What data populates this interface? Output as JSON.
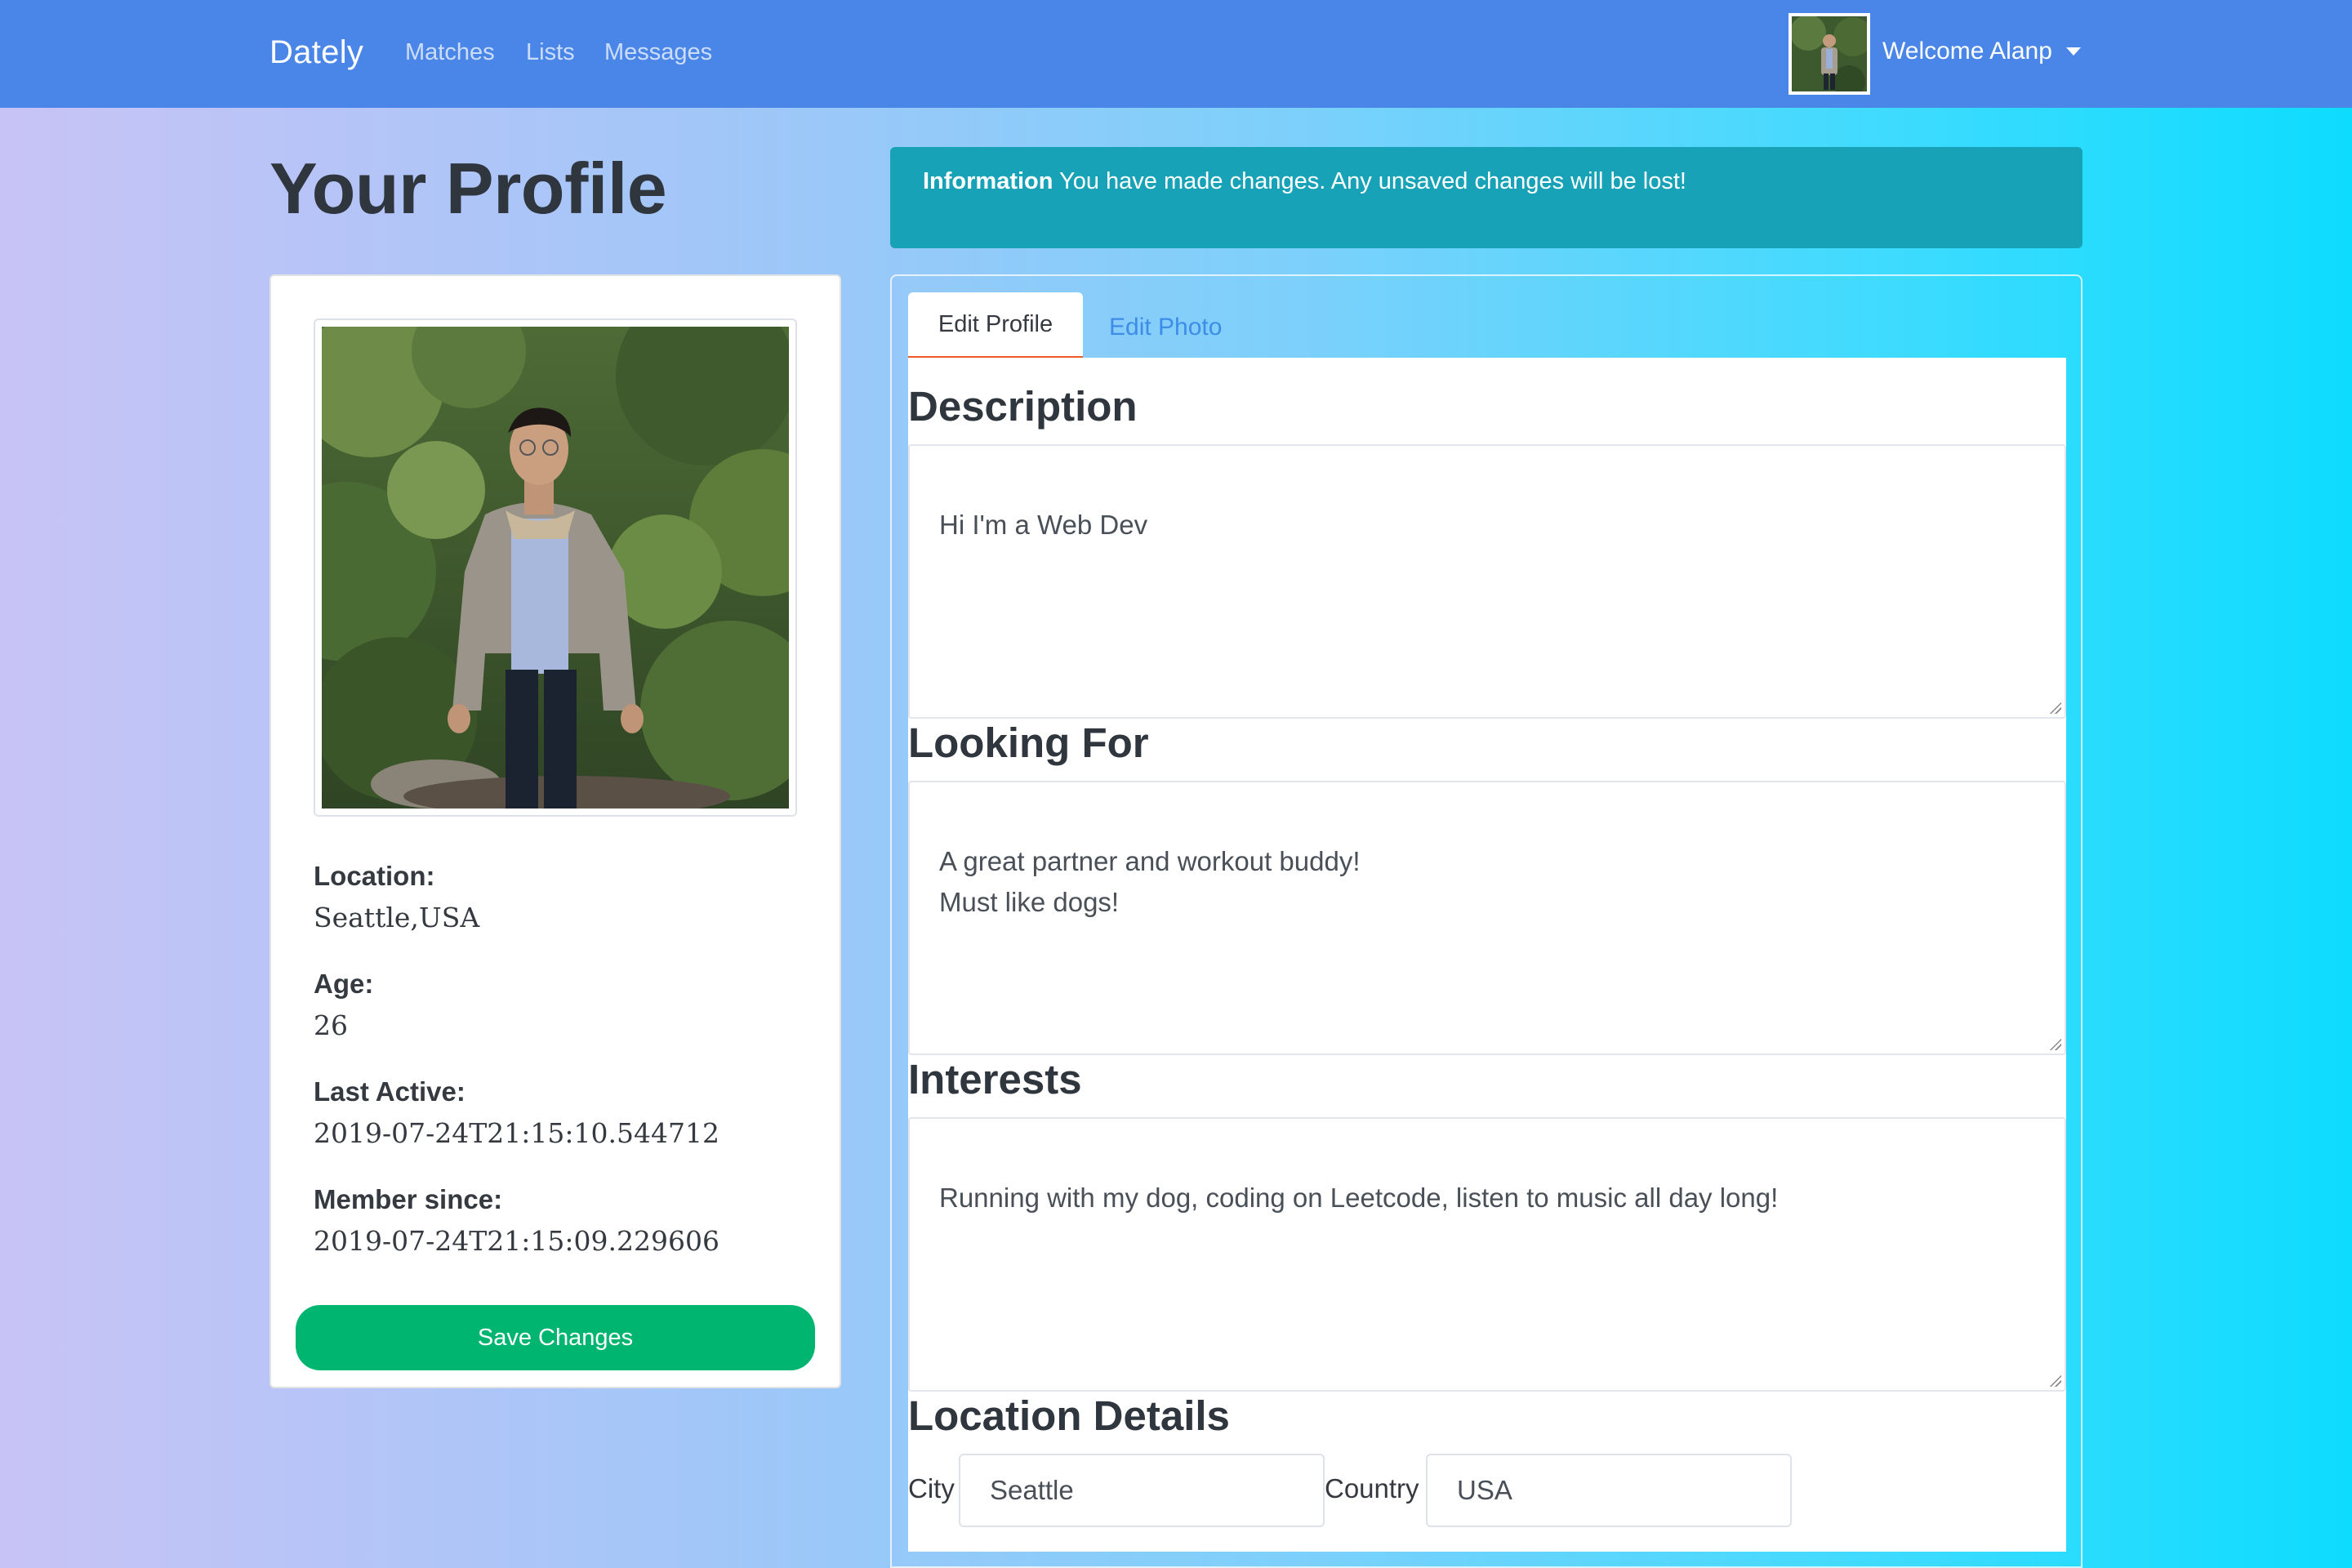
{
  "navbar": {
    "brand": "Dately",
    "links": [
      {
        "label": "Matches"
      },
      {
        "label": "Lists"
      },
      {
        "label": "Messages"
      }
    ],
    "welcome": "Welcome Alanp"
  },
  "page": {
    "title": "Your Profile"
  },
  "alert": {
    "strong": "Information",
    "text": " You have made changes. Any unsaved changes will be lost!"
  },
  "profile_card": {
    "details": [
      {
        "label": "Location:",
        "value": "Seattle,USA"
      },
      {
        "label": "Age:",
        "value": "26"
      },
      {
        "label": "Last Active:",
        "value": "2019-07-24T21:15:10.544712"
      },
      {
        "label": "Member since:",
        "value": "2019-07-24T21:15:09.229606"
      }
    ],
    "save_label": "Save Changes"
  },
  "tabs": [
    {
      "label": "Edit Profile",
      "active": true
    },
    {
      "label": "Edit Photo",
      "active": false
    }
  ],
  "edit_form": {
    "description": {
      "heading": "Description",
      "value": "Hi I'm a Web Dev"
    },
    "looking_for": {
      "heading": "Looking For",
      "value": "A great partner and workout buddy!\nMust like dogs!"
    },
    "interests": {
      "heading": "Interests",
      "value": "Running with my dog, coding on Leetcode, listen to music all day long!"
    },
    "location": {
      "heading": "Location Details",
      "city_label": "City",
      "city_value": "Seattle",
      "country_label": "Country",
      "country_value": "USA"
    }
  },
  "colors": {
    "navbar": "#4a86e8",
    "alert": "#18a2b8",
    "save_button": "#00b56f",
    "active_tab_underline": "#f05a28",
    "tab_link": "#3c8ce8"
  }
}
